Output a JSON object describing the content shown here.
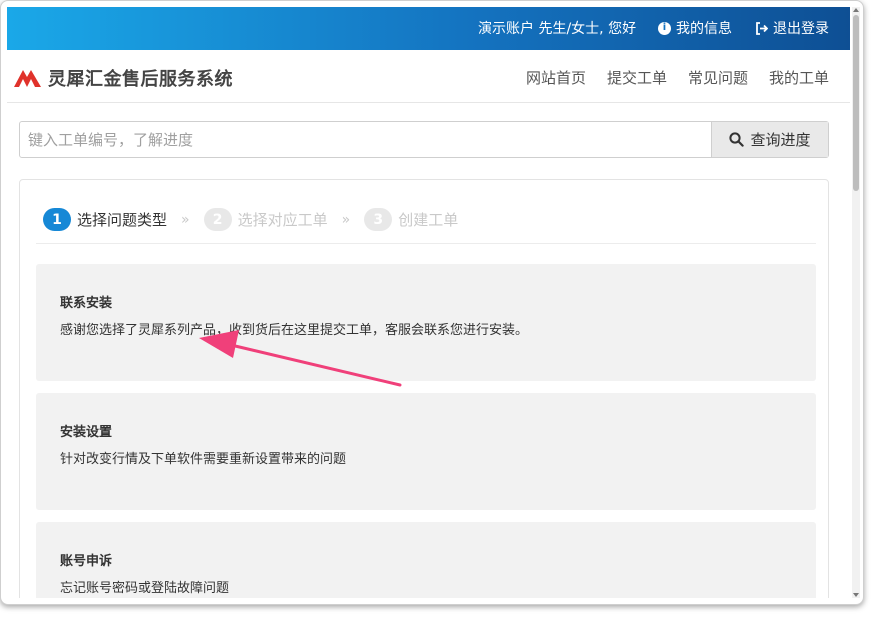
{
  "topbar": {
    "greeting": "演示账户 先生/女士, 您好",
    "my_info": "我的信息",
    "logout": "退出登录"
  },
  "navbar": {
    "brand": "灵犀汇金售后服务系统",
    "items": [
      "网站首页",
      "提交工单",
      "常见问题",
      "我的工单"
    ]
  },
  "search": {
    "placeholder": "键入工单编号，了解进度",
    "button_label": "查询进度"
  },
  "steps": [
    {
      "num": "1",
      "label": "选择问题类型"
    },
    {
      "num": "2",
      "label": "选择对应工单"
    },
    {
      "num": "3",
      "label": "创建工单"
    }
  ],
  "step_separator": "»",
  "issue_types": [
    {
      "title": "联系安装",
      "desc": "感谢您选择了灵犀系列产品，收到货后在这里提交工单，客服会联系您进行安装。"
    },
    {
      "title": "安装设置",
      "desc": "针对改变行情及下单软件需要重新设置带来的问题"
    },
    {
      "title": "账号申诉",
      "desc": "忘记账号密码或登陆故障问题"
    }
  ],
  "colors": {
    "accent": "#1688d6",
    "annotation_arrow": "#f0407a"
  }
}
